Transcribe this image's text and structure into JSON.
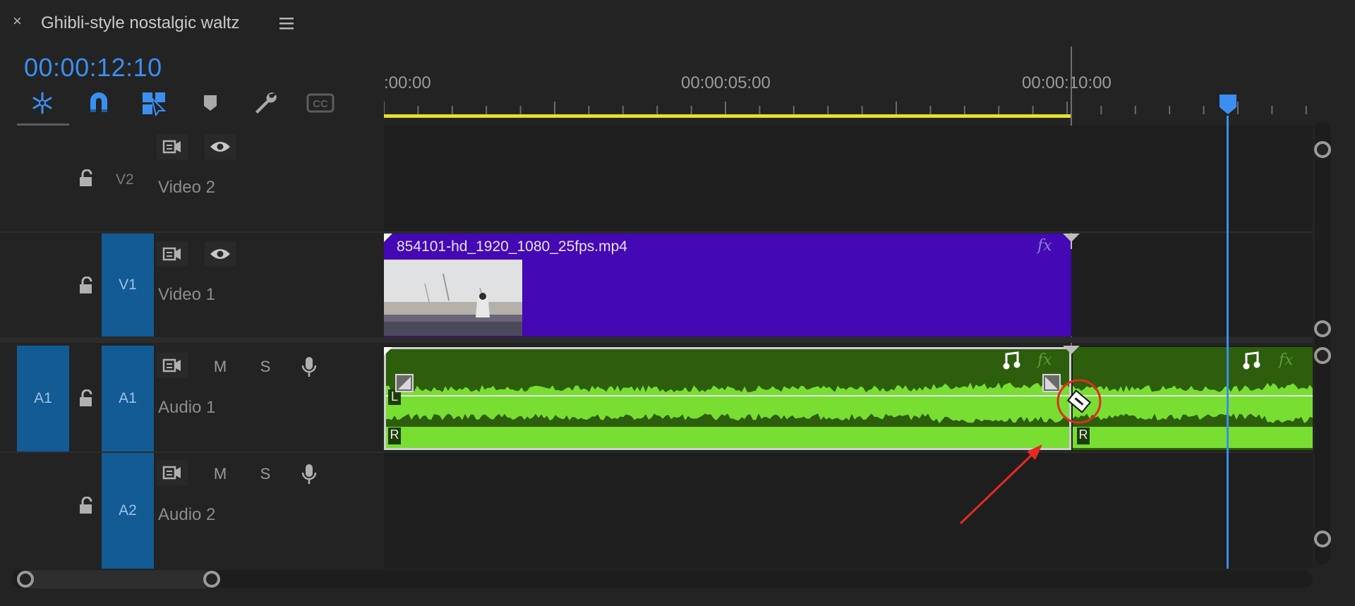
{
  "panel": {
    "close_icon": "close-icon",
    "title": "Ghibli-style nostalgic waltz",
    "menu_icon": "hamburger-menu-icon",
    "timecode": "00:00:12:10"
  },
  "toolbar": {
    "tools": [
      "insert-nest-icon",
      "snap-magnet-icon",
      "linked-selection-icon",
      "add-marker-icon",
      "settings-wrench-icon",
      "captions-cc-icon"
    ],
    "captions_label": "CC"
  },
  "ruler": {
    "labels": [
      ":00:00",
      "00:00:05:00",
      "00:00:10:00"
    ],
    "playhead_color": "#3a8ff0",
    "work_area_color": "#e4e02a"
  },
  "tracks": {
    "v2": {
      "id": "V2",
      "name": "Video 2"
    },
    "v1": {
      "id": "V1",
      "name": "Video 1"
    },
    "a1": {
      "source": "A1",
      "id": "A1",
      "name": "Audio 1",
      "mute": "M",
      "solo": "S"
    },
    "a2": {
      "id": "A2",
      "name": "Audio 2",
      "mute": "M",
      "solo": "S"
    }
  },
  "clips": {
    "video": {
      "name": "854101-hd_1920_1080_25fps.mp4",
      "fx": "fx",
      "color": "#4408b4"
    },
    "audio_left": {
      "fx": "fx",
      "channel_l": "L",
      "channel_r": "R",
      "color": "#2d5e0c"
    },
    "audio_right": {
      "fx": "fx",
      "channel_r": "R"
    }
  },
  "cursor": {
    "tool": "razor-tool-cursor-icon"
  }
}
